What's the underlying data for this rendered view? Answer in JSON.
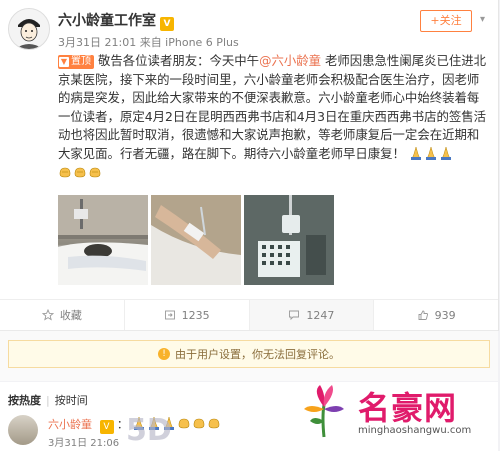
{
  "post": {
    "username": "六小龄童工作室",
    "meta": "3月31日 21:01 来自 iPhone 6 Plus",
    "follow_label": "+关注",
    "pinned_label": "置顶",
    "body_before_mention": "敬告各位读者朋友：今天中午",
    "mention": "@六小龄童",
    "body_after_mention": " 老师因患急性阑尾炎已住进北京某医院，接下来的一段时间里，六小龄童老师会积极配合医生治疗，因老师的病是突发，因此给大家带来的不便深表歉意。六小龄童老师心中始终装着每一位读者，原定4月2日在昆明西西弗书店和4月3日在重庆西西弗书店的签售活动也将因此暂时取消，很遗憾和大家说声抱歉，等老师康复后一定会在近期和大家见面。行者无疆，路在脚下。期待六小龄童老师早日康复！",
    "emojis_inline": [
      "pray",
      "pray",
      "pray"
    ],
    "emojis_row": [
      "fist",
      "fist",
      "fist"
    ]
  },
  "actions": {
    "favorite_label": "收藏",
    "repost_count": "1235",
    "comment_count": "1247",
    "like_count": "939"
  },
  "notice": {
    "text": "由于用户设置，你无法回复评论。"
  },
  "comments": {
    "sort_hot": "按热度",
    "sort_time": "按时间",
    "first": {
      "username": "六小龄童",
      "time": "3月31日 21:06",
      "emojis": [
        "pray",
        "pray",
        "pray",
        "fist",
        "fist",
        "fist"
      ]
    }
  },
  "watermark": {
    "brand": "名豪网",
    "url": "minghaoshangwu.com",
    "left_brand": "5D"
  },
  "colors": {
    "accent": "#ff8140",
    "link": "#eb7350",
    "watermark": "#e01b6b"
  }
}
